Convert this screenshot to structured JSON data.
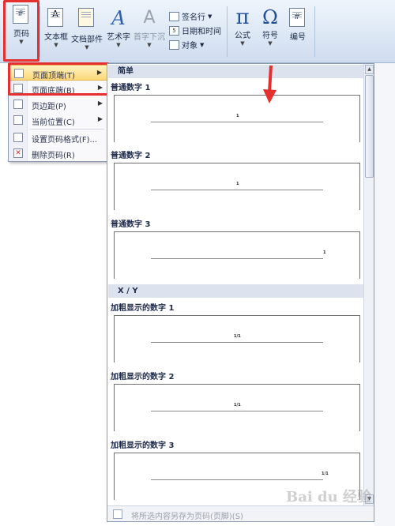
{
  "ribbon": {
    "page_number": "页码",
    "text_box": "文本框",
    "quick_parts": "文档部件",
    "wordart": "艺术字",
    "drop_cap": "首字下沉",
    "signature_line": "签名行",
    "date_time": "日期和时间",
    "object": "对象",
    "equation": "公式",
    "symbol": "符号",
    "numbering": "编号",
    "page_icon_glyph": "#",
    "text_box_glyph": "A",
    "wordart_glyph": "A",
    "drop_cap_glyph": "A",
    "equation_glyph": "π",
    "symbol_glyph": "Ω",
    "numbering_glyph": "#",
    "date_glyph": "5"
  },
  "menu": {
    "items": [
      {
        "label": "页面顶端(T)",
        "icon": "page-top-icon",
        "submenu": true
      },
      {
        "label": "页面底端(B)",
        "icon": "page-bottom-icon",
        "submenu": true
      },
      {
        "label": "页边距(P)",
        "icon": "page-margin-icon",
        "submenu": true
      },
      {
        "label": "当前位置(C)",
        "icon": "current-position-icon",
        "submenu": true
      },
      {
        "label": "设置页码格式(F)...",
        "icon": "format-page-number-icon",
        "submenu": false
      },
      {
        "label": "删除页码(R)",
        "icon": "remove-page-number-icon",
        "submenu": false
      }
    ],
    "submenu_arrow": "▶"
  },
  "gallery": {
    "section_simple": "简单",
    "section_xy": "X / Y",
    "items": [
      {
        "title": "普通数字 1",
        "preview": "1"
      },
      {
        "title": "普通数字 2",
        "preview": "1"
      },
      {
        "title": "普通数字 3",
        "preview": "1"
      },
      {
        "title": "加粗显示的数字 1",
        "preview": "1/1"
      },
      {
        "title": "加粗显示的数字 2",
        "preview": "1/1"
      },
      {
        "title": "加粗显示的数字 3",
        "preview": "1/1"
      }
    ],
    "footer": "将所选内容另存为页码(页脚)(S)",
    "scroll_up": "▲",
    "scroll_down": "▼"
  },
  "watermark": "Bai du 经验",
  "colors": {
    "highlight": "#e62f2f",
    "active_item": "#ffd77a"
  }
}
